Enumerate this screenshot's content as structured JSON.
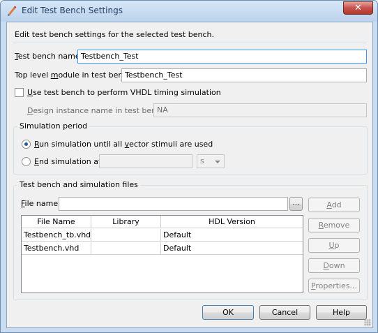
{
  "window": {
    "title": "Edit Test Bench Settings",
    "close_glyph": "✕",
    "icon": "pencil-icon"
  },
  "description": "Edit test bench settings for the selected test bench.",
  "fields": {
    "test_bench_name": {
      "label_prefix": "",
      "label_key": "T",
      "label_rest": "est bench name:",
      "value": "Testbench_Test"
    },
    "top_level_module": {
      "label_prefix": "Top level ",
      "label_key": "m",
      "label_rest": "odule in test bench:",
      "value": "Testbench_Test"
    },
    "use_timing_sim": {
      "label_prefix": "",
      "label_key": "U",
      "label_rest": "se test bench to perform VHDL timing simulation",
      "checked": false
    },
    "design_instance": {
      "label_prefix": "",
      "label_key": "D",
      "label_rest": "esign instance name in test bench:",
      "value": "NA"
    }
  },
  "simulation_period": {
    "title": "Simulation period",
    "run_all": {
      "label_prefix": "",
      "label_key": "R",
      "label_rest": "un simulation until all ",
      "label_key2": "v",
      "label_rest2": "ector stimuli are used",
      "selected": true
    },
    "end_at": {
      "label_prefix": "",
      "label_key": "E",
      "label_rest": "nd simulation at:",
      "selected": false,
      "value": "",
      "unit": "s"
    }
  },
  "files_group": {
    "title": "Test bench and simulation files",
    "file_name_label_prefix": "",
    "file_name_label_key": "F",
    "file_name_label_rest": "ile name:",
    "file_name_value": "",
    "browse_label": "...",
    "columns": [
      "File Name",
      "Library",
      "HDL Version"
    ],
    "rows": [
      {
        "file": "Testbench_tb.vhd",
        "library": "",
        "hdl": "Default"
      },
      {
        "file": "Testbench.vhd",
        "library": "",
        "hdl": "Default"
      }
    ],
    "buttons": {
      "add": {
        "key": "A",
        "rest": "dd"
      },
      "remove": {
        "key": "R",
        "rest": "emove"
      },
      "up": {
        "key": "U",
        "rest": "p"
      },
      "down": {
        "key": "D",
        "rest": "own"
      },
      "properties": {
        "key": "P",
        "rest": "roperties..."
      }
    }
  },
  "footer": {
    "ok": "OK",
    "cancel": "Cancel",
    "help": "Help"
  }
}
